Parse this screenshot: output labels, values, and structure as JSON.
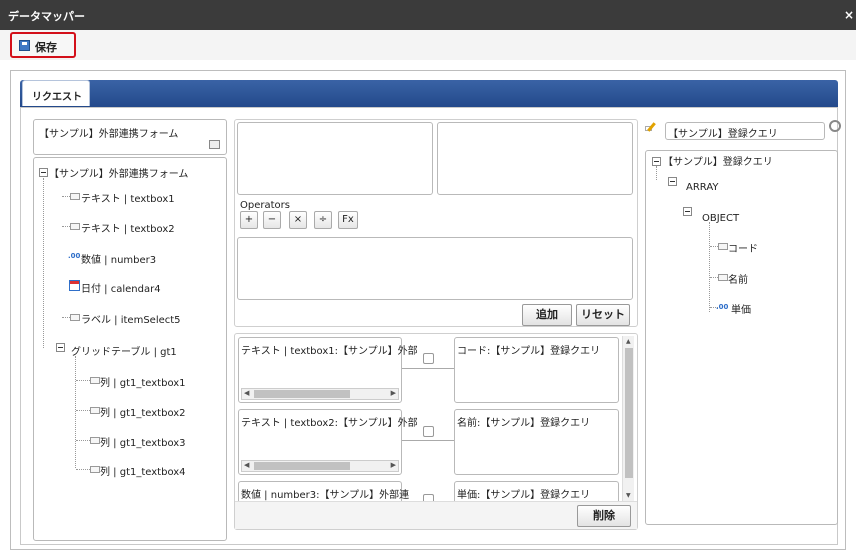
{
  "window": {
    "title": "データマッパー",
    "close": "×"
  },
  "toolbar": {
    "save_label": "保存"
  },
  "tabs": [
    {
      "label": "リクエスト"
    }
  ],
  "left": {
    "form_select": "【サンプル】外部連携フォーム",
    "tree_root": "【サンプル】外部連携フォーム",
    "items": [
      {
        "label": "テキスト | textbox1",
        "icon": "field-icon"
      },
      {
        "label": "テキスト | textbox2",
        "icon": "field-icon"
      },
      {
        "label": "数値 | number3",
        "icon": "number-icon"
      },
      {
        "label": "日付 | calendar4",
        "icon": "calendar-icon"
      },
      {
        "label": "ラベル | itemSelect5",
        "icon": "field-icon"
      }
    ],
    "grid": {
      "label": "グリッドテーブル | gt1",
      "children": [
        {
          "label": "列 | gt1_textbox1"
        },
        {
          "label": "列 | gt1_textbox2"
        },
        {
          "label": "列 | gt1_textbox3"
        },
        {
          "label": "列 | gt1_textbox4"
        }
      ]
    }
  },
  "middle": {
    "operators_label": "Operators",
    "operators": [
      "+",
      "−",
      "×",
      "÷",
      "Fx"
    ],
    "add_label": "追加",
    "reset_label": "リセット",
    "delete_label": "削除",
    "mappings": [
      {
        "source": "テキスト | textbox1:【サンプル】外部",
        "target": "コード:【サンプル】登録クエリ"
      },
      {
        "source": "テキスト | textbox2:【サンプル】外部",
        "target": "名前:【サンプル】登録クエリ"
      },
      {
        "source": "数値 | number3:【サンプル】外部連",
        "target": "単価:【サンプル】登録クエリ"
      }
    ]
  },
  "right": {
    "query_select": "【サンプル】登録クエリ",
    "tree_root": "【サンプル】登録クエリ",
    "array_label": "ARRAY",
    "object_label": "OBJECT",
    "fields": [
      {
        "label": "コード",
        "icon": "field-icon"
      },
      {
        "label": "名前",
        "icon": "field-icon"
      },
      {
        "label": "単価",
        "icon": "number-icon"
      }
    ]
  },
  "icons": {
    "number_glyph": ".00"
  },
  "colors": {
    "tab_bar": "#2a4f8f",
    "title_bar": "#3b3b3b",
    "highlight": "#d3101a"
  }
}
